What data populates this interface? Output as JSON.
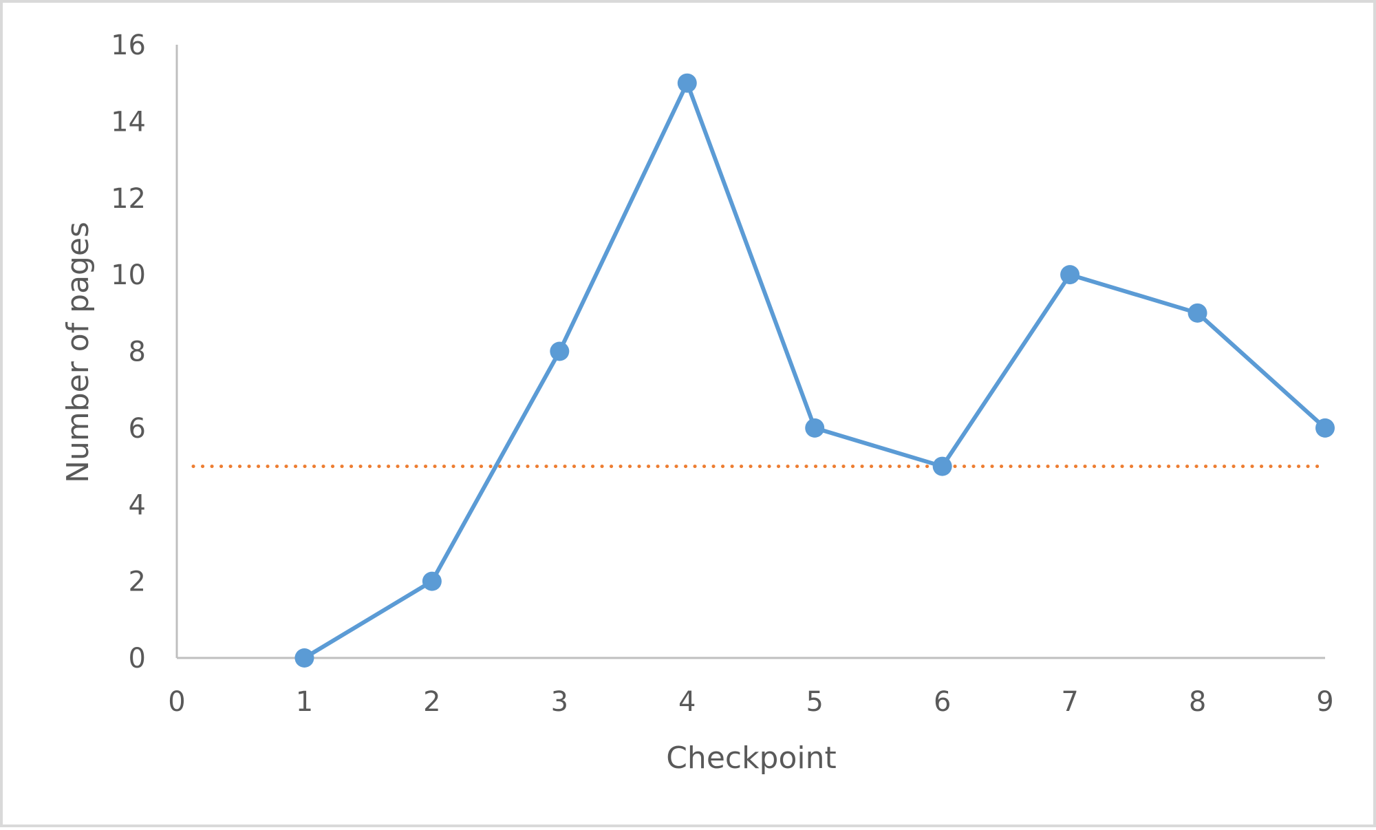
{
  "chart_data": {
    "type": "line",
    "title": "",
    "xlabel": "Checkpoint",
    "ylabel": "Number of pages",
    "xlim": [
      0,
      9
    ],
    "ylim": [
      0,
      16
    ],
    "x_ticks": [
      0,
      1,
      2,
      3,
      4,
      5,
      6,
      7,
      8,
      9
    ],
    "y_ticks": [
      0,
      2,
      4,
      6,
      8,
      10,
      12,
      14,
      16
    ],
    "grid": false,
    "legend": "none",
    "series": [
      {
        "x": [
          1,
          2,
          3,
          4,
          5,
          6,
          7,
          8,
          9
        ],
        "values": [
          0,
          2,
          8,
          15,
          6,
          5,
          10,
          9,
          6
        ],
        "color": "#5b9bd5",
        "marker": "circle"
      }
    ],
    "reference_lines": [
      {
        "y": 5,
        "style": "dotted",
        "color": "#ed7d31",
        "x_range": [
          0,
          9
        ]
      }
    ],
    "axis_color": "#bfbfbf",
    "text_color": "#595959"
  }
}
